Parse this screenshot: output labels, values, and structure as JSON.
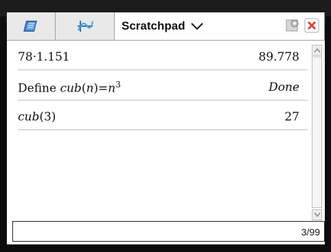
{
  "tabs": [
    {
      "name": "calculator",
      "label": ""
    },
    {
      "name": "graphs",
      "label": ""
    },
    {
      "name": "scratchpad",
      "label": "Scratchpad"
    }
  ],
  "history": [
    {
      "input": "78·1.151",
      "output": "89.778"
    },
    {
      "input_prefix": "Define ",
      "input_func": "cub",
      "input_arg": "(n)",
      "input_eq": "=",
      "input_var": "n",
      "input_sup": "3",
      "output": "Done"
    },
    {
      "input_func": "cub",
      "input_arg": "(3)",
      "output": "27"
    }
  ],
  "entry_line": {
    "value": "",
    "counter": "3/99"
  },
  "icons": {
    "tab1": "calculator-app-icon",
    "tab2": "graphs-app-icon",
    "dropdown": "chevron-down-icon",
    "gear": "document-settings-icon",
    "close": "close-icon"
  },
  "colors": {
    "close": "#d9433f",
    "accent": "#2f6db6"
  }
}
